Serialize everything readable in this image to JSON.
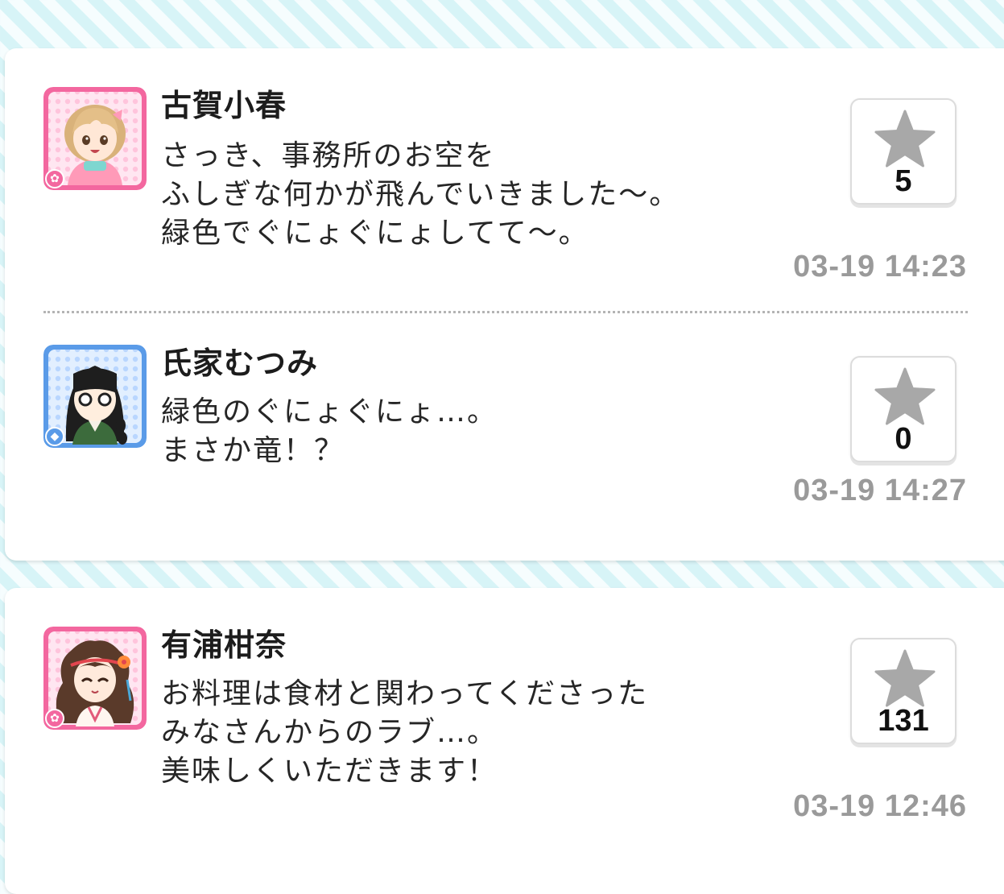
{
  "colors": {
    "bg_stripe": "#d7f4f7",
    "card": "#ffffff",
    "star": "#a8a8a8",
    "timestamp": "#9a9a9a",
    "cute_frame": "#f3679f",
    "cool_frame": "#5a9be8"
  },
  "posts": [
    {
      "name": "古賀小春",
      "lines": [
        "さっき、事務所のお空を",
        "ふしぎな何かが飛んでいきました～。",
        "緑色でぐにょぐにょしてて～。"
      ],
      "likes": "5",
      "time": "03-19 14:23",
      "avatar_icon": "flower-icon"
    },
    {
      "name": "氏家むつみ",
      "lines": [
        "緑色のぐにょぐにょ…。",
        "まさか竜！？"
      ],
      "likes": "0",
      "time": "03-19 14:27",
      "avatar_icon": "diamond-icon"
    },
    {
      "name": "有浦柑奈",
      "lines": [
        "お料理は食材と関わってくださった",
        "みなさんからのラブ…。",
        "美味しくいただきます！"
      ],
      "likes": "131",
      "time": "03-19 12:46",
      "avatar_icon": "flower-icon"
    }
  ]
}
